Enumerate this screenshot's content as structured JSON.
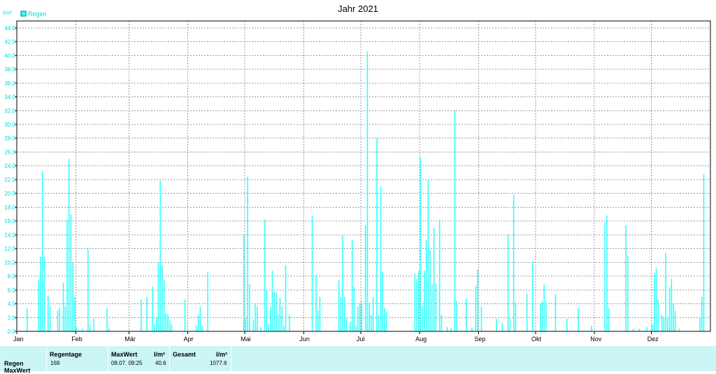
{
  "chart_data": {
    "type": "bar",
    "title": "Jahr 2021",
    "ylabel": "l/m²",
    "ylim": [
      0,
      45
    ],
    "yticks": [
      "0.0",
      "2.0",
      "4.0",
      "6.0",
      "8.0",
      "10.0",
      "12.0",
      "14.0",
      "16.0",
      "18.0",
      "20.0",
      "22.0",
      "24.0",
      "26.0",
      "28.0",
      "30.0",
      "32.0",
      "34.0",
      "36.0",
      "38.0",
      "40.0",
      "42.0",
      "44.0"
    ],
    "xlim": [
      1,
      365
    ],
    "months": [
      {
        "label": "Jan",
        "day": 1
      },
      {
        "label": "Feb",
        "day": 32
      },
      {
        "label": "Mär",
        "day": 60
      },
      {
        "label": "Apr",
        "day": 91
      },
      {
        "label": "Mai",
        "day": 121
      },
      {
        "label": "Jun",
        "day": 152
      },
      {
        "label": "Jul",
        "day": 182
      },
      {
        "label": "Aug",
        "day": 213
      },
      {
        "label": "Sep",
        "day": 244
      },
      {
        "label": "Okt",
        "day": 274
      },
      {
        "label": "Nov",
        "day": 305
      },
      {
        "label": "Dez",
        "day": 335
      }
    ],
    "grid": true,
    "legend": "top-left",
    "color": "#33ffff",
    "series": [
      {
        "name": "Regen",
        "points": [
          [
            6,
            3.4
          ],
          [
            12,
            7.5
          ],
          [
            13,
            10.8
          ],
          [
            14,
            23.2
          ],
          [
            15,
            10.8
          ],
          [
            17,
            5.2
          ],
          [
            18,
            3.6
          ],
          [
            22,
            3.0
          ],
          [
            23,
            3.4
          ],
          [
            25,
            7.0
          ],
          [
            26,
            3.6
          ],
          [
            27,
            16.2
          ],
          [
            28,
            25.0
          ],
          [
            29,
            17.0
          ],
          [
            30,
            10.0
          ],
          [
            31,
            5.0
          ],
          [
            32,
            0.6
          ],
          [
            35,
            0.4
          ],
          [
            38,
            12.0
          ],
          [
            39,
            1.0
          ],
          [
            41,
            1.8
          ],
          [
            48,
            3.4
          ],
          [
            49,
            0.4
          ],
          [
            66,
            4.6
          ],
          [
            69,
            5.0
          ],
          [
            72,
            6.5
          ],
          [
            73,
            1.0
          ],
          [
            74,
            2.0
          ],
          [
            75,
            10.0
          ],
          [
            76,
            21.8
          ],
          [
            77,
            9.6
          ],
          [
            78,
            7.5
          ],
          [
            79,
            2.6
          ],
          [
            80,
            2.4
          ],
          [
            81,
            1.6
          ],
          [
            82,
            1.0
          ],
          [
            89,
            4.6
          ],
          [
            95,
            0.8
          ],
          [
            96,
            2.4
          ],
          [
            97,
            3.6
          ],
          [
            98,
            0.8
          ],
          [
            101,
            8.6
          ],
          [
            120,
            14.0
          ],
          [
            121,
            2.0
          ],
          [
            122,
            22.4
          ],
          [
            123,
            6.8
          ],
          [
            125,
            1.6
          ],
          [
            126,
            4.0
          ],
          [
            127,
            3.6
          ],
          [
            129,
            0.6
          ],
          [
            131,
            16.2
          ],
          [
            132,
            6.0
          ],
          [
            133,
            1.0
          ],
          [
            134,
            3.6
          ],
          [
            135,
            8.8
          ],
          [
            136,
            5.8
          ],
          [
            137,
            5.6
          ],
          [
            138,
            2.4
          ],
          [
            139,
            4.8
          ],
          [
            140,
            3.6
          ],
          [
            141,
            0.8
          ],
          [
            142,
            9.6
          ],
          [
            144,
            2.4
          ],
          [
            156,
            16.8
          ],
          [
            158,
            8.2
          ],
          [
            159,
            3.0
          ],
          [
            160,
            5.0
          ],
          [
            170,
            7.4
          ],
          [
            171,
            5.0
          ],
          [
            172,
            14.0
          ],
          [
            173,
            5.0
          ],
          [
            174,
            2.0
          ],
          [
            176,
            1.4
          ],
          [
            177,
            13.2
          ],
          [
            178,
            6.4
          ],
          [
            179,
            0.8
          ],
          [
            180,
            3.6
          ],
          [
            181,
            4.0
          ],
          [
            182,
            4.4
          ],
          [
            184,
            15.4
          ],
          [
            185,
            40.6
          ],
          [
            186,
            4.2
          ],
          [
            187,
            2.4
          ],
          [
            188,
            5.0
          ],
          [
            190,
            28.0
          ],
          [
            191,
            2.4
          ],
          [
            192,
            21.0
          ],
          [
            193,
            8.6
          ],
          [
            194,
            3.4
          ],
          [
            195,
            2.8
          ],
          [
            210,
            8.4
          ],
          [
            211,
            7.6
          ],
          [
            212,
            8.8
          ],
          [
            213,
            25.2
          ],
          [
            214,
            3.6
          ],
          [
            215,
            8.8
          ],
          [
            216,
            13.2
          ],
          [
            217,
            22.0
          ],
          [
            218,
            11.8
          ],
          [
            219,
            6.8
          ],
          [
            220,
            15.0
          ],
          [
            221,
            7.0
          ],
          [
            223,
            16.2
          ],
          [
            224,
            2.4
          ],
          [
            227,
            0.6
          ],
          [
            229,
            0.4
          ],
          [
            231,
            32.0
          ],
          [
            232,
            4.4
          ],
          [
            237,
            4.8
          ],
          [
            240,
            0.6
          ],
          [
            242,
            6.6
          ],
          [
            243,
            9.0
          ],
          [
            245,
            3.6
          ],
          [
            253,
            1.8
          ],
          [
            256,
            1.2
          ],
          [
            259,
            14.0
          ],
          [
            260,
            2.0
          ],
          [
            262,
            19.8
          ],
          [
            263,
            4.2
          ],
          [
            269,
            5.4
          ],
          [
            272,
            10.2
          ],
          [
            276,
            4.0
          ],
          [
            277,
            4.4
          ],
          [
            278,
            6.8
          ],
          [
            279,
            4.4
          ],
          [
            284,
            5.4
          ],
          [
            290,
            1.8
          ],
          [
            296,
            3.4
          ],
          [
            303,
            0.8
          ],
          [
            310,
            15.8
          ],
          [
            311,
            16.8
          ],
          [
            312,
            3.4
          ],
          [
            321,
            15.4
          ],
          [
            322,
            11.0
          ],
          [
            325,
            0.4
          ],
          [
            328,
            0.4
          ],
          [
            332,
            0.6
          ],
          [
            335,
            1.0
          ],
          [
            336,
            8.4
          ],
          [
            337,
            9.2
          ],
          [
            338,
            4.6
          ],
          [
            340,
            2.4
          ],
          [
            341,
            2.0
          ],
          [
            342,
            11.4
          ],
          [
            343,
            2.0
          ],
          [
            344,
            6.4
          ],
          [
            345,
            7.6
          ],
          [
            346,
            4.0
          ],
          [
            347,
            3.0
          ],
          [
            349,
            0.4
          ],
          [
            360,
            2.0
          ],
          [
            361,
            5.0
          ],
          [
            362,
            22.8
          ]
        ]
      }
    ]
  },
  "stats": {
    "row_label": "Regen",
    "row_label_2": "MaxWert",
    "regentage_header": "Regentage",
    "regentage_value": "169",
    "maxwert_header": "MaxWert",
    "maxwert_unit": "l/m²",
    "maxwert_date": "08.07.  09:25",
    "maxwert_value": "40.6",
    "gesamt_header": "Gesamt",
    "gesamt_unit": "l/m²",
    "gesamt_value": "1077.6"
  }
}
